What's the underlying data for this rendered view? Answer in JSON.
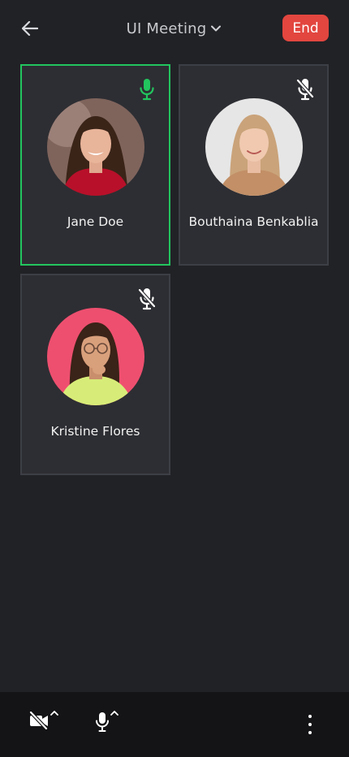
{
  "header": {
    "title": "UI Meeting",
    "end_label": "End"
  },
  "participants": [
    {
      "name": "Jane Doe",
      "mic": "on",
      "speaking": true,
      "avatar_bg": "#8a6a60",
      "shirt": "#b8102a",
      "hair": "#3a2418",
      "skin": "#e8b49a"
    },
    {
      "name": "Bouthaina Benkablia",
      "mic": "muted",
      "speaking": false,
      "avatar_bg": "#e4e4e4",
      "shirt": "#c28f66",
      "hair": "#caa37a",
      "skin": "#f0c9b0"
    },
    {
      "name": "Kristine Flores",
      "mic": "muted",
      "speaking": false,
      "avatar_bg": "#ee4f6f",
      "shirt": "#d7ec78",
      "hair": "#3a2318",
      "skin": "#d9a07c"
    }
  ],
  "colors": {
    "background": "#212226",
    "tile": "#2d2e33",
    "speaking_border": "#22c55e",
    "end_button": "#e2463f",
    "mic_active": "#22c55e"
  },
  "icons": {
    "back": "arrow-left-icon",
    "dropdown": "chevron-down-icon",
    "mic_on": "microphone-icon",
    "mic_off": "microphone-off-icon",
    "camera_off": "video-off-icon",
    "more": "more-vertical-icon"
  }
}
